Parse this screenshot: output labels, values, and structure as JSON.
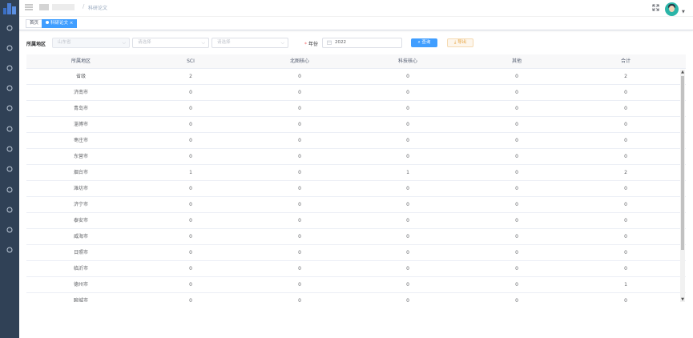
{
  "sidebar": {
    "icons": [
      "dashboard-icon",
      "user-icon",
      "document-icon",
      "eye-icon",
      "clock-icon",
      "table-icon",
      "shield-icon",
      "grid-icon",
      "book-icon",
      "archive-icon",
      "gear-icon",
      "monitor-icon"
    ]
  },
  "navbar": {
    "breadcrumb_current": "科研论文",
    "separator": "/"
  },
  "tags": {
    "home": "首页",
    "active": "科研论文",
    "active_close": "×"
  },
  "filters": {
    "region_label": "所属地区",
    "province_placeholder": "山东省",
    "city_placeholder": "请选择",
    "county_placeholder": "请选择",
    "year_required": "*",
    "year_label": "年份",
    "year_value": "2022",
    "query_button": "查询",
    "export_button": "导出"
  },
  "table": {
    "headers": [
      "所属地区",
      "SCI",
      "北图核心",
      "科技核心",
      "其他",
      "合计"
    ],
    "rows": [
      [
        "省级",
        "2",
        "0",
        "0",
        "0",
        "2"
      ],
      [
        "济南市",
        "0",
        "0",
        "0",
        "0",
        "0"
      ],
      [
        "青岛市",
        "0",
        "0",
        "0",
        "0",
        "0"
      ],
      [
        "淄博市",
        "0",
        "0",
        "0",
        "0",
        "0"
      ],
      [
        "枣庄市",
        "0",
        "0",
        "0",
        "0",
        "0"
      ],
      [
        "东营市",
        "0",
        "0",
        "0",
        "0",
        "0"
      ],
      [
        "烟台市",
        "1",
        "0",
        "1",
        "0",
        "2"
      ],
      [
        "潍坊市",
        "0",
        "0",
        "0",
        "0",
        "0"
      ],
      [
        "济宁市",
        "0",
        "0",
        "0",
        "0",
        "0"
      ],
      [
        "泰安市",
        "0",
        "0",
        "0",
        "0",
        "0"
      ],
      [
        "威海市",
        "0",
        "0",
        "0",
        "0",
        "0"
      ],
      [
        "日照市",
        "0",
        "0",
        "0",
        "0",
        "0"
      ],
      [
        "临沂市",
        "0",
        "0",
        "0",
        "0",
        "0"
      ],
      [
        "德州市",
        "0",
        "0",
        "0",
        "0",
        "1"
      ],
      [
        "聊城市",
        "0",
        "0",
        "0",
        "0",
        "0"
      ]
    ]
  },
  "colors": {
    "sidebar": "#304156",
    "primary": "#409eff",
    "warning": "#e6a23c"
  }
}
